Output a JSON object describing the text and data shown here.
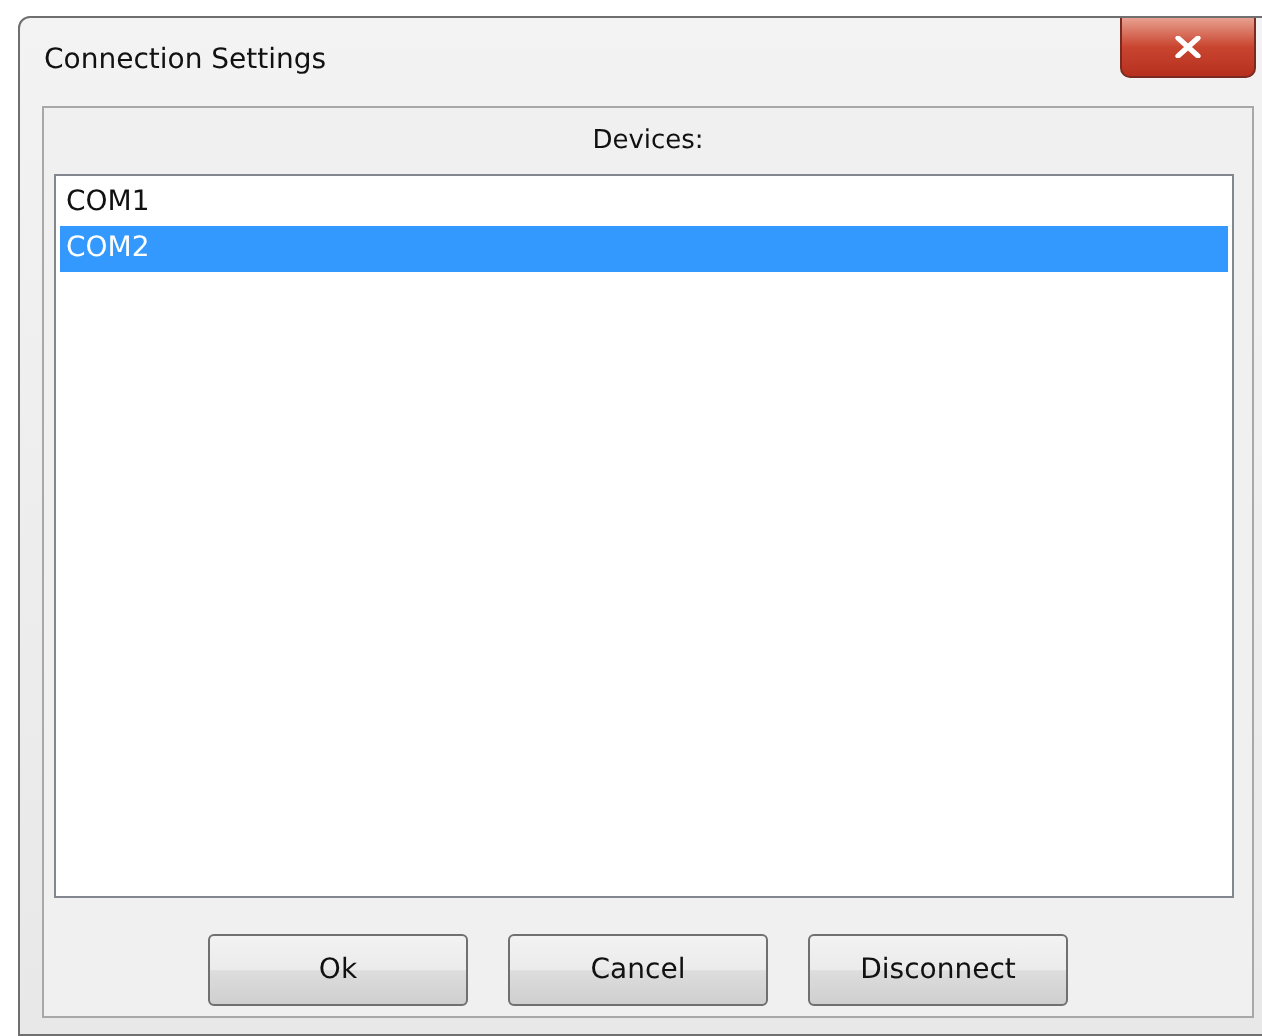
{
  "window": {
    "title": "Connection Settings"
  },
  "devices": {
    "label": "Devices:",
    "items": [
      {
        "name": "COM1",
        "selected": false
      },
      {
        "name": "COM2",
        "selected": true
      }
    ]
  },
  "buttons": [
    "Ok",
    "Cancel",
    "Disconnect"
  ]
}
